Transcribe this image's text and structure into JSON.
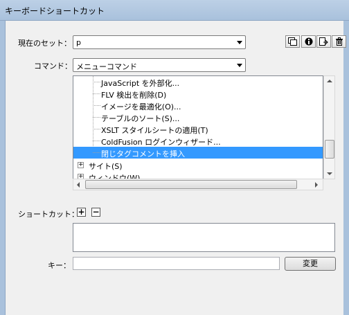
{
  "window": {
    "title": "キーボードショートカット"
  },
  "current_set": {
    "label": "現在のセット：",
    "value": "p"
  },
  "command": {
    "label": "コマンド：",
    "value": "メニューコマンド"
  },
  "toolbar": {
    "icons": [
      "duplicate-set-icon",
      "rename-set-icon",
      "export-set-icon",
      "delete-set-icon"
    ],
    "rename_glyph": "ℹ"
  },
  "tree": {
    "items": [
      {
        "label": "JavaScript を外部化...",
        "level": 2,
        "selected": false
      },
      {
        "label": "FLV 検出を削除(D)",
        "level": 2,
        "selected": false
      },
      {
        "label": "イメージを最適化(O)...",
        "level": 2,
        "selected": false
      },
      {
        "label": "テーブルのソート(S)...",
        "level": 2,
        "selected": false
      },
      {
        "label": "XSLT スタイルシートの適用(T)",
        "level": 2,
        "selected": false
      },
      {
        "label": "ColdFusion ログインウィザード...",
        "level": 2,
        "selected": false
      },
      {
        "label": "閉じタグコメントを挿入",
        "level": 2,
        "selected": true
      },
      {
        "label": "サイト(S)",
        "level": 1,
        "selected": false,
        "expander": "+"
      },
      {
        "label": "ウィンドウ(W)",
        "level": 1,
        "selected": false,
        "expander": "+"
      }
    ]
  },
  "shortcut": {
    "label": "ショートカット：",
    "add": "+",
    "remove": "−"
  },
  "key": {
    "label": "キー：",
    "value": "",
    "change_button": "変更"
  },
  "colors": {
    "selection": "#3399ff",
    "title_bar": "#bcd0e6"
  }
}
